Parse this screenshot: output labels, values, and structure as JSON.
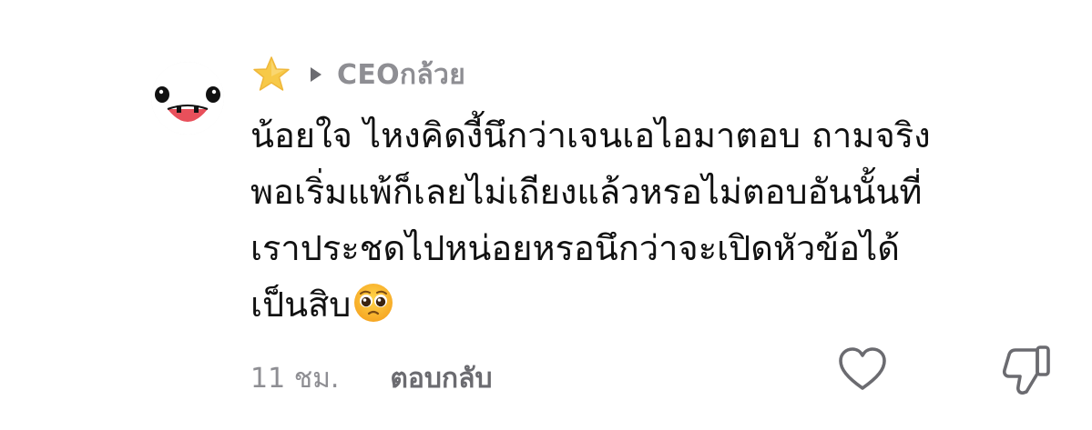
{
  "comment": {
    "avatar_icon": "panda-face-avatar",
    "badge_icon": "star-icon",
    "caret_icon": "caret-right-icon",
    "username": "CEOกล้วย",
    "body_lines": [
      "น้อยใจ ไหงคิดงี้นึกว่าเจนเอไอมาตอบ ถามจริง",
      "พอเริ่มแพ้ก็เลยไม่เถียงแล้วหรอไม่ตอบอันนั้นที่",
      "เราประชดไปหน่อยหรอนึกว่าจะเปิดหัวข้อได้",
      "เป็นสิบ"
    ],
    "end_emoji": "pleading-face-emoji",
    "timestamp": "11 ชม.",
    "reply_label": "ตอบกลับ",
    "like_icon": "heart-outline-icon",
    "dislike_icon": "thumbs-down-outline-icon",
    "colors": {
      "username": "#8e8e93",
      "meta": "#8e8e93",
      "reply": "#6b6b70",
      "text": "#111111",
      "star": "#f7c948",
      "icon_stroke": "#6b6b70"
    }
  }
}
